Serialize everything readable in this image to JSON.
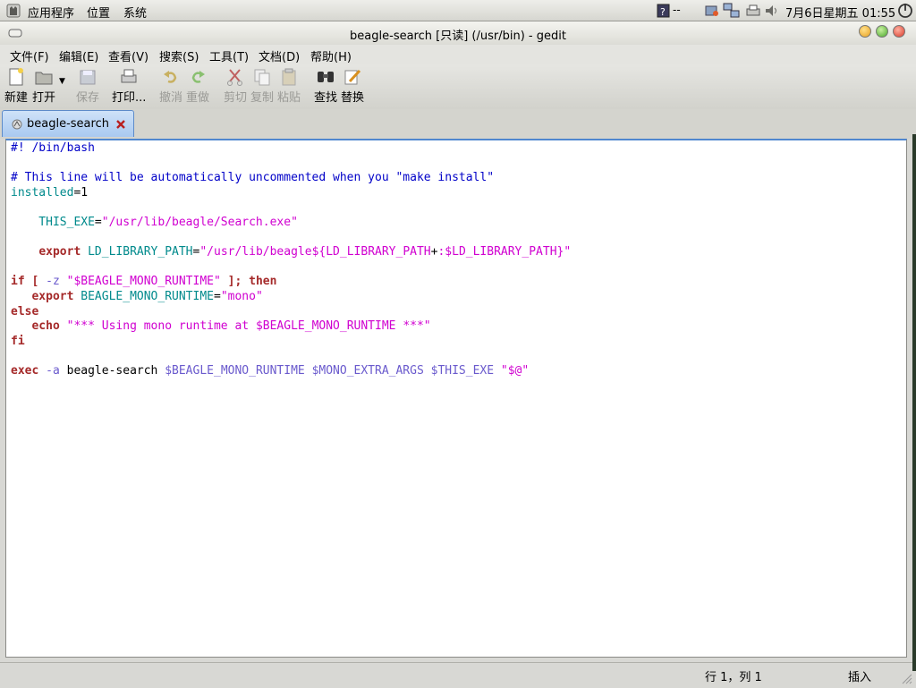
{
  "panel": {
    "menus": [
      "应用程序",
      "位置",
      "系统"
    ],
    "help_text": "--",
    "clock": "7月6日星期五 01:55"
  },
  "window": {
    "title": "beagle-search [只读] (/usr/bin) - gedit"
  },
  "menubar": [
    "文件(F)",
    "编辑(E)",
    "查看(V)",
    "搜索(S)",
    "工具(T)",
    "文档(D)",
    "帮助(H)"
  ],
  "toolbar": {
    "new": "新建",
    "open": "打开",
    "save": "保存",
    "print": "打印...",
    "undo": "撤消",
    "redo": "重做",
    "cut": "剪切",
    "copy": "复制",
    "paste": "粘贴",
    "find": "查找",
    "replace": "替换"
  },
  "tab": {
    "label": "beagle-search"
  },
  "code_lines": [
    [
      {
        "t": "#! /bin/bash",
        "c": "comment"
      }
    ],
    [],
    [
      {
        "t": "# This line will be automatically uncommented when you \"make install\"",
        "c": "comment"
      }
    ],
    [
      {
        "t": "installed",
        "c": "var"
      },
      {
        "t": "=1",
        "c": "plain"
      }
    ],
    [],
    [
      {
        "t": "    THIS_EXE",
        "c": "var"
      },
      {
        "t": "=",
        "c": "plain"
      },
      {
        "t": "\"/usr/lib/beagle/Search.exe\"",
        "c": "str"
      }
    ],
    [],
    [
      {
        "t": "    ",
        "c": "plain"
      },
      {
        "t": "export",
        "c": "kw"
      },
      {
        "t": " LD_LIBRARY_PATH",
        "c": "var"
      },
      {
        "t": "=",
        "c": "plain"
      },
      {
        "t": "\"/usr/lib/beagle",
        "c": "str"
      },
      {
        "t": "${LD_LIBRARY_PATH",
        "c": "str"
      },
      {
        "t": "+",
        "c": "plain"
      },
      {
        "t": ":$LD_LIBRARY_PATH}\"",
        "c": "str"
      }
    ],
    [],
    [
      {
        "t": "if",
        "c": "kw"
      },
      {
        "t": " ",
        "c": "plain"
      },
      {
        "t": "[",
        "c": "kw"
      },
      {
        "t": " -z ",
        "c": "op"
      },
      {
        "t": "\"$BEAGLE_MONO_RUNTIME\"",
        "c": "str"
      },
      {
        "t": " ",
        "c": "plain"
      },
      {
        "t": "];",
        "c": "kw"
      },
      {
        "t": " ",
        "c": "plain"
      },
      {
        "t": "then",
        "c": "kw"
      }
    ],
    [
      {
        "t": "   ",
        "c": "plain"
      },
      {
        "t": "export",
        "c": "kw"
      },
      {
        "t": " BEAGLE_MONO_RUNTIME",
        "c": "var"
      },
      {
        "t": "=",
        "c": "plain"
      },
      {
        "t": "\"mono\"",
        "c": "str"
      }
    ],
    [
      {
        "t": "else",
        "c": "kw"
      }
    ],
    [
      {
        "t": "   ",
        "c": "plain"
      },
      {
        "t": "echo",
        "c": "kw"
      },
      {
        "t": " \"*** Using mono runtime at ",
        "c": "str"
      },
      {
        "t": "$BEAGLE_MONO_RUNTIME",
        "c": "str"
      },
      {
        "t": " ***\"",
        "c": "str"
      }
    ],
    [
      {
        "t": "fi",
        "c": "kw"
      }
    ],
    [],
    [
      {
        "t": "exec",
        "c": "kw"
      },
      {
        "t": " -a ",
        "c": "op"
      },
      {
        "t": "beagle-search ",
        "c": "plain"
      },
      {
        "t": "$BEAGLE_MONO_RUNTIME $MONO_EXTRA_ARGS $THIS_EXE ",
        "c": "sub"
      },
      {
        "t": "\"$@\"",
        "c": "str"
      }
    ]
  ],
  "statusbar": {
    "position": "行 1，列 1",
    "mode": "插入"
  }
}
